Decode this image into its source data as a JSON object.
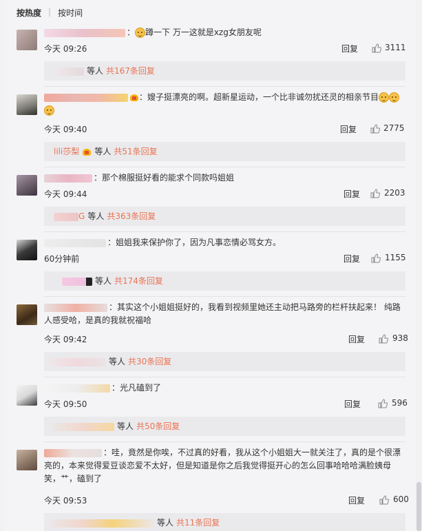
{
  "sort": {
    "hot_label": "按热度",
    "time_label": "按时间"
  },
  "comments": [
    {
      "text": "蹲一下 万一这就是xzg女朋友呢",
      "time": "今天 09:26",
      "reply": "回复",
      "likes": "3111",
      "replies_label": "等人",
      "replies_count": "共167条回复"
    },
    {
      "text": "嫂子挺漂亮的啊。超新星运动，一个比非诚勿扰还灵的相亲节目",
      "time": "今天 09:40",
      "reply": "回复",
      "likes": "2775",
      "replier": "lili莎梨",
      "replies_label": "等人",
      "replies_count": "共51条回复"
    },
    {
      "text": "那个棉服挺好看的能求个同款吗姐姐",
      "time": "今天 09:44",
      "reply": "回复",
      "likes": "2203",
      "replier_fragment": "G",
      "replies_label": "等人",
      "replies_count": "共363条回复"
    },
    {
      "text": "姐姐我来保护你了，因为凡事恋情必骂女方。",
      "time": "60分钟前",
      "reply": "回复",
      "likes": "1155",
      "replies_label": "等人",
      "replies_count": "共174条回复"
    },
    {
      "text": "其实这个小姐姐挺好的，我看到视频里她还主动把马路旁的栏杆扶起来！ 纯路人感受哈，是真的我就祝福哈",
      "time": "今天 09:42",
      "reply": "回复",
      "likes": "938",
      "replies_label": "等人",
      "replies_count": "共30条回复"
    },
    {
      "text": "光凡磕到了",
      "time": "今天 09:50",
      "reply": "回复",
      "likes": "596",
      "replies_label": "等人",
      "replies_count": "共50条回复"
    },
    {
      "text": "哇，竟然是你唉，不过真的好看，我从这个小姐姐大一就关注了，真的是个很漂亮的，本来觉得爱豆谈恋爱不太好，但是知道是你之后我觉得挺开心的怎么回事哈哈哈满脸姨母笑，艹，磕到了",
      "time": "今天 09:53",
      "reply": "回复",
      "likes": "600",
      "replies_label": "等人",
      "replies_count": "共11条回复"
    }
  ],
  "colors": {
    "link": "#eb7350",
    "text": "#333333",
    "bg": "#f4f4f6"
  }
}
